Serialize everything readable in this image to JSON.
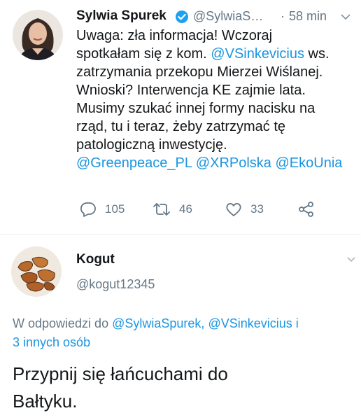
{
  "tweet": {
    "author_name": "Sylwia Spurek",
    "author_handle": "@SylwiaS…",
    "time": "58 min",
    "lines": [
      "Uwaga: zła informacja! Wczoraj",
      "spotkałam się z kom.",
      "zatrzymania przekopu Mierzei Wiślanej.",
      "Wnioski? Interwencja KE zajmie lata.",
      "Musimy szukać innej formy nacisku na",
      "rząd, tu i teraz, żeby zatrzymać tę",
      "patologiczną inwestycję."
    ],
    "mention_inline": "@VSinkevicius",
    "mention_inline_after": " ws.",
    "mentions": [
      "@Greenpeace_PL",
      "@XRPolska",
      "@EkoUnia"
    ],
    "replies": "105",
    "retweets": "46",
    "likes": "33"
  },
  "reply": {
    "author_name": "Kogut",
    "author_handle": "@kogut12345",
    "replying_prefix": "W odpowiedzi do",
    "replying_to": [
      "@SylwiaSpurek,",
      "@VSinkevicius i"
    ],
    "replying_more": "3 innych osób",
    "text_lines": [
      "Przypnij się łańcuchami do",
      "Bałtyku."
    ]
  },
  "icons": {
    "verified": "verified-badge-icon",
    "chevron": "chevron-down-icon",
    "reply": "reply-icon",
    "retweet": "retweet-icon",
    "like": "heart-icon",
    "share": "share-icon"
  },
  "colors": {
    "link": "#1b95e0",
    "muted": "#657786",
    "verified": "#1da1f2",
    "text": "#14171a"
  }
}
